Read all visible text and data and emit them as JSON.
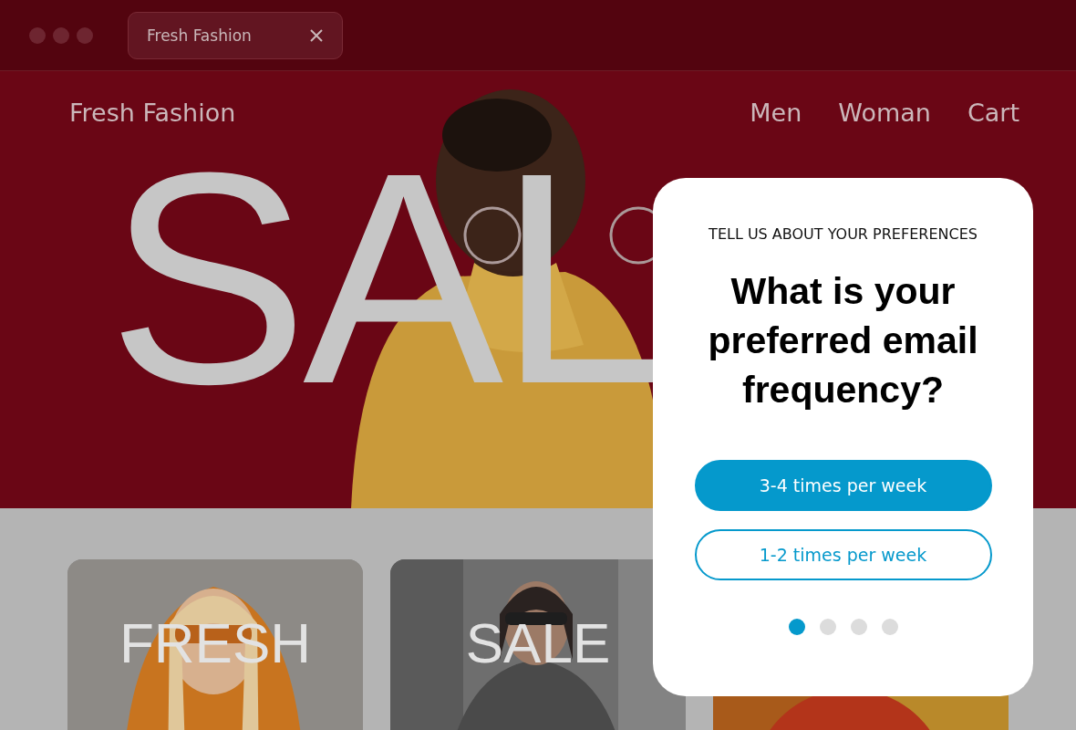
{
  "browser": {
    "tab": {
      "title": "Fresh Fashion"
    }
  },
  "site": {
    "brand": "Fresh Fashion",
    "nav": [
      {
        "label": "Men"
      },
      {
        "label": "Woman"
      },
      {
        "label": "Cart"
      }
    ]
  },
  "hero": {
    "headline": "SAL"
  },
  "cards": [
    {
      "kind": "picture",
      "label": "FRESH"
    },
    {
      "kind": "picture",
      "label": "SALE"
    },
    {
      "kind": "picture"
    }
  ],
  "popup": {
    "eyebrow": "TELL US ABOUT YOUR PREFERENCES",
    "question": "What is your preferred email frequency?",
    "options": [
      {
        "label": "3-4 times per week",
        "selected": true
      },
      {
        "label": "1-2 times per week",
        "selected": false
      }
    ],
    "pages": [
      {
        "selected": true
      },
      {
        "selected": false
      },
      {
        "selected": false
      },
      {
        "selected": false
      }
    ]
  }
}
